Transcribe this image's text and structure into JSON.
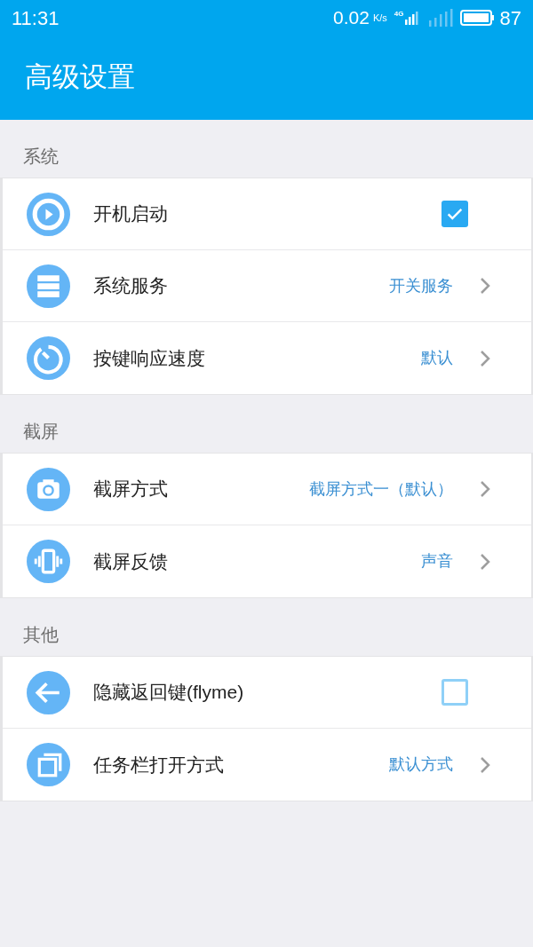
{
  "status_bar": {
    "time": "11:31",
    "speed": "0.02",
    "speed_unit": "K/s",
    "network": "4G",
    "battery": "87"
  },
  "title": "高级设置",
  "sections": [
    {
      "title": "系统",
      "rows": [
        {
          "kind": "checkbox",
          "label": "开机启动",
          "checked": true
        },
        {
          "kind": "link",
          "label": "系统服务",
          "value": "开关服务"
        },
        {
          "kind": "link",
          "label": "按键响应速度",
          "value": "默认"
        }
      ]
    },
    {
      "title": "截屏",
      "rows": [
        {
          "kind": "link",
          "label": "截屏方式",
          "value": "截屏方式一（默认）"
        },
        {
          "kind": "link",
          "label": "截屏反馈",
          "value": "声音"
        }
      ]
    },
    {
      "title": "其他",
      "rows": [
        {
          "kind": "checkbox",
          "label": "隐藏返回键(flyme)",
          "checked": false
        },
        {
          "kind": "link",
          "label": "任务栏打开方式",
          "value": "默认方式"
        }
      ]
    }
  ]
}
